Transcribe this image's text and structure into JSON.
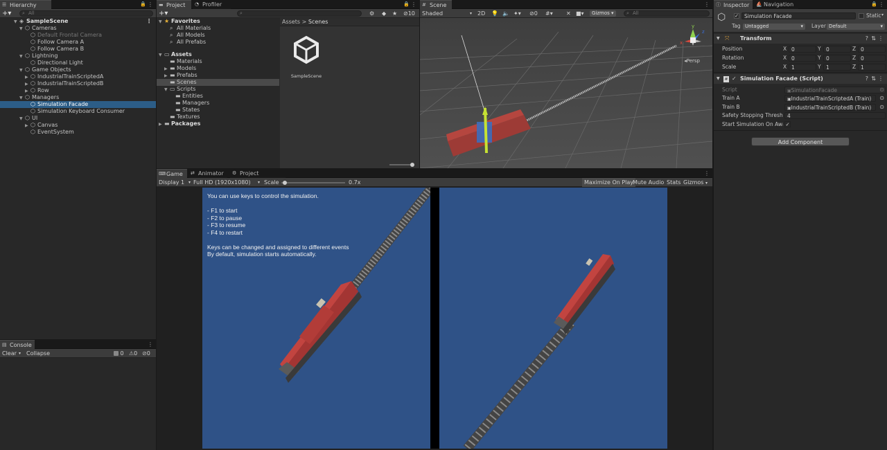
{
  "hierarchy": {
    "tab": "Hierarchy",
    "search_placeholder": "All",
    "items": [
      {
        "label": "SampleScene"
      },
      {
        "label": "Cameras"
      },
      {
        "label": "Default Frontal Camera"
      },
      {
        "label": "Follow Camera A"
      },
      {
        "label": "Follow Camera B"
      },
      {
        "label": "Lightning"
      },
      {
        "label": "Directional Light"
      },
      {
        "label": "Game Objects"
      },
      {
        "label": "IndustrialTrainScriptedA"
      },
      {
        "label": "IndustrialTrainScriptedB"
      },
      {
        "label": "Row"
      },
      {
        "label": "Managers"
      },
      {
        "label": "Simulation Facade"
      },
      {
        "label": "Simulation Keyboard Consumer"
      },
      {
        "label": "UI"
      },
      {
        "label": "Canvas"
      },
      {
        "label": "EventSystem"
      }
    ]
  },
  "console": {
    "tab": "Console",
    "clear": "Clear",
    "collapse": "Collapse",
    "counts": [
      "0",
      "0",
      "0"
    ]
  },
  "project": {
    "tabs": [
      "Project",
      "Profiler"
    ],
    "favorites": {
      "label": "Favorites",
      "items": [
        "All Materials",
        "All Models",
        "All Prefabs"
      ]
    },
    "assets_label": "Assets",
    "assets_items": [
      "Materials",
      "Models",
      "Prefabs",
      "Scenes",
      "Scripts",
      "Entities",
      "Managers",
      "States",
      "Textures"
    ],
    "packages_label": "Packages",
    "breadcrumb": [
      "Assets",
      "Scenes"
    ],
    "asset_item": "SampleScene",
    "hidden_count": "10"
  },
  "scene": {
    "tab": "Scene",
    "shading": "Shaded",
    "mode_2d": "2D",
    "gizmos": "Gizmos",
    "search_placeholder": "All",
    "persp": "Persp",
    "fx_count": "0"
  },
  "game": {
    "tabs": [
      "Game",
      "Animator",
      "Project Settings"
    ],
    "display": "Display 1",
    "resolution": "Full HD (1920x1080)",
    "scale_label": "Scale",
    "scale_value": "0.7x",
    "scale_fraction": 0.05,
    "buttons": [
      "Maximize On Play",
      "Mute Audio",
      "Stats",
      "Gizmos"
    ],
    "overlay_text": [
      "You can use keys to control the simulation.",
      "",
      "- F1 to start",
      "- F2 to pause",
      "- F3 to resume",
      "- F4 to restart",
      "",
      "Keys can be changed and assigned to different events",
      "By default, simulation starts automatically."
    ],
    "view_color": "#2f5287"
  },
  "inspector": {
    "tabs": [
      "Inspector",
      "Navigation"
    ],
    "object_name": "Simulation Facade",
    "static_label": "Static",
    "tag_label": "Tag",
    "tag_value": "Untagged",
    "layer_label": "Layer",
    "layer_value": "Default",
    "transform": {
      "title": "Transform",
      "rows": [
        {
          "label": "Position",
          "x": "0",
          "y": "0",
          "z": "0"
        },
        {
          "label": "Rotation",
          "x": "0",
          "y": "0",
          "z": "0"
        },
        {
          "label": "Scale",
          "x": "1",
          "y": "1",
          "z": "1"
        }
      ]
    },
    "script_component": {
      "title": "Simulation Facade (Script)",
      "rows": [
        {
          "label": "Script",
          "value": "SimulationFacade"
        },
        {
          "label": "Train A",
          "value": "IndustrialTrainScriptedA (Train)"
        },
        {
          "label": "Train B",
          "value": "IndustrialTrainScriptedB (Train)"
        },
        {
          "label": "Safety Stopping Thresho",
          "value": "4"
        },
        {
          "label": "Start Simulation On Awa",
          "value": "✓"
        }
      ]
    },
    "add_component": "Add Component"
  }
}
